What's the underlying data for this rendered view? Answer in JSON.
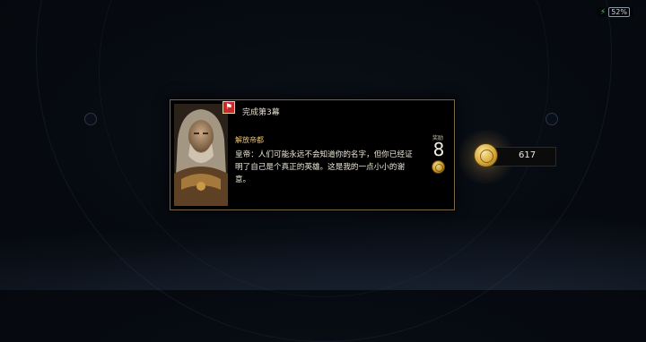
{
  "status_bar": {
    "battery": "52%"
  },
  "quest_card": {
    "title": "完成第3幕",
    "mission_name": "解放帝都",
    "dialog": "皇帝：人们可能永远不会知道你的名字，但你已经证明了自己是个真正的英雄。这是我的一点小小的谢意。",
    "reward_label": "奖励",
    "reward_value": "8",
    "portrait_icon": "emperor-portrait",
    "badge_icon": "map-marker-icon",
    "reward_icon": "gold-coin-icon"
  },
  "currency": {
    "value": "617",
    "icon": "gold-coin-icon"
  },
  "colors": {
    "accent_gold": "#f0c46a",
    "badge_red": "#c62a2a",
    "border_bronze": "#7a6a48",
    "battery_green": "#4ad06a"
  }
}
